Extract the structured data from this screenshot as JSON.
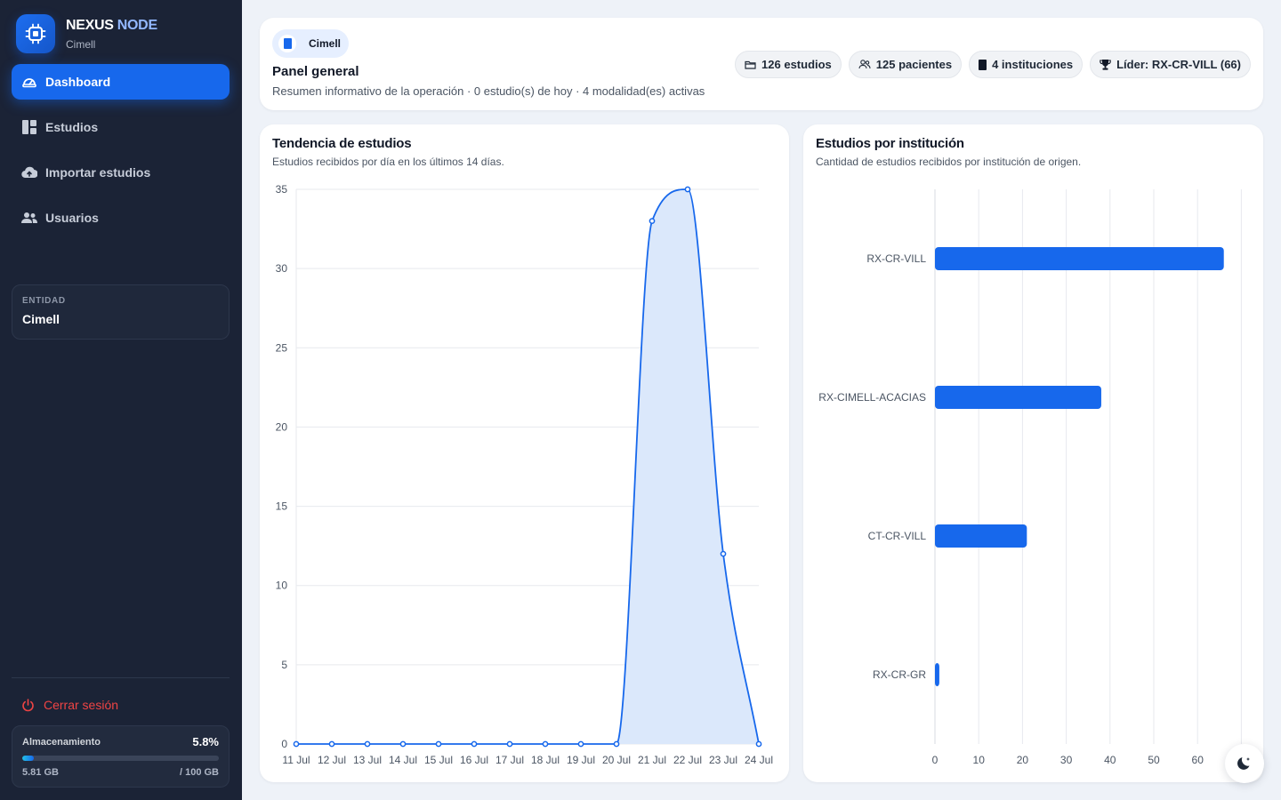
{
  "brand": {
    "title_main": "NEXUS",
    "title_accent": " NODE",
    "subtitle": "Cimell"
  },
  "nav": [
    {
      "label": "Dashboard",
      "icon": "gauge-icon",
      "active": true
    },
    {
      "label": "Estudios",
      "icon": "grid-icon",
      "active": false
    },
    {
      "label": "Importar estudios",
      "icon": "cloud-upload-icon",
      "active": false
    },
    {
      "label": "Usuarios",
      "icon": "users-icon",
      "active": false
    }
  ],
  "entity": {
    "label": "ENTIDAD",
    "value": "Cimell"
  },
  "logout": {
    "label": "Cerrar sesión"
  },
  "storage": {
    "label": "Almacenamiento",
    "percent": "5.8%",
    "fraction": 0.058,
    "used": "5.81 GB",
    "total": "/ 100 GB"
  },
  "header": {
    "org": "Cimell",
    "title": "Panel general",
    "subtitle": "Resumen informativo de la operación · 0 estudio(s) de hoy · 4 modalidad(es) activas",
    "chips": [
      {
        "label": "126 estudios",
        "icon": "folder-icon"
      },
      {
        "label": "125 pacientes",
        "icon": "users-icon"
      },
      {
        "label": "4 instituciones",
        "icon": "building-icon"
      },
      {
        "label": "Líder: RX-CR-VILL (66)",
        "icon": "trophy-icon"
      }
    ]
  },
  "colors": {
    "accent": "#1768ec",
    "sidebar": "#1b2336",
    "danger": "#ef4444"
  },
  "trend": {
    "title": "Tendencia de estudios",
    "subtitle": "Estudios recibidos por día en los últimos 14 días.",
    "chart_data": {
      "type": "area",
      "categories": [
        "11 Jul",
        "12 Jul",
        "13 Jul",
        "14 Jul",
        "15 Jul",
        "16 Jul",
        "17 Jul",
        "18 Jul",
        "19 Jul",
        "20 Jul",
        "21 Jul",
        "22 Jul",
        "23 Jul",
        "24 Jul"
      ],
      "values": [
        0,
        0,
        0,
        0,
        0,
        0,
        0,
        0,
        0,
        0,
        33,
        35,
        12,
        0
      ],
      "ylim": [
        0,
        35
      ],
      "yticks": [
        0,
        5,
        10,
        15,
        20,
        25,
        30,
        35
      ],
      "grid": true,
      "color": "#1768ec",
      "fill": "#dbe8fb"
    }
  },
  "institutions": {
    "title": "Estudios por institución",
    "subtitle": "Cantidad de estudios recibidos por institución de origen.",
    "chart_data": {
      "type": "bar",
      "orientation": "horizontal",
      "categories": [
        "RX-CR-VILL",
        "RX-CIMELL-ACACIAS",
        "CT-CR-VILL",
        "RX-CR-GR"
      ],
      "values": [
        66,
        38,
        21,
        1
      ],
      "xlim": [
        0,
        70
      ],
      "xticks": [
        0,
        10,
        20,
        30,
        40,
        50,
        60
      ],
      "grid": true,
      "color": "#1768ec"
    }
  }
}
